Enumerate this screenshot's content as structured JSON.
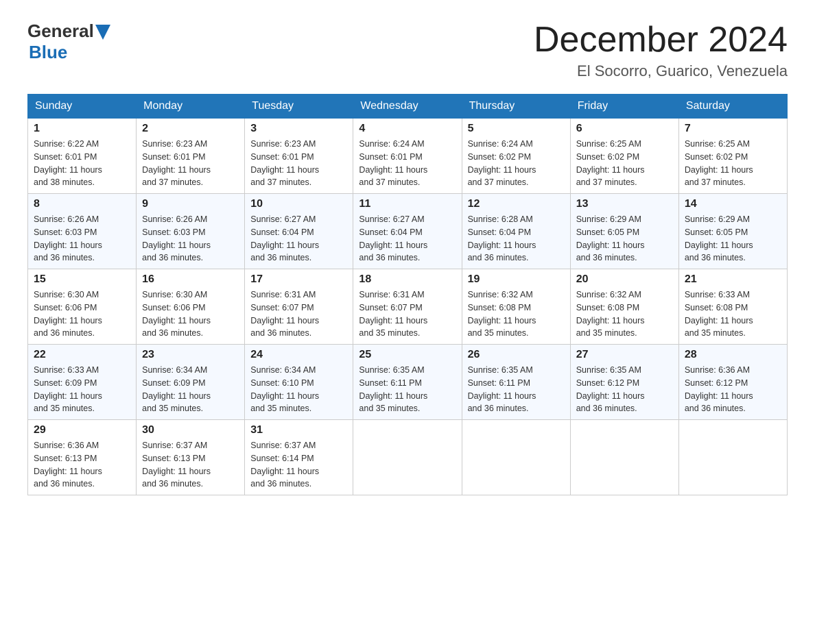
{
  "header": {
    "logo_general": "General",
    "logo_blue": "Blue",
    "month_title": "December 2024",
    "location": "El Socorro, Guarico, Venezuela"
  },
  "days_of_week": [
    "Sunday",
    "Monday",
    "Tuesday",
    "Wednesday",
    "Thursday",
    "Friday",
    "Saturday"
  ],
  "weeks": [
    [
      {
        "day": "1",
        "sunrise": "6:22 AM",
        "sunset": "6:01 PM",
        "daylight": "11 hours and 38 minutes."
      },
      {
        "day": "2",
        "sunrise": "6:23 AM",
        "sunset": "6:01 PM",
        "daylight": "11 hours and 37 minutes."
      },
      {
        "day": "3",
        "sunrise": "6:23 AM",
        "sunset": "6:01 PM",
        "daylight": "11 hours and 37 minutes."
      },
      {
        "day": "4",
        "sunrise": "6:24 AM",
        "sunset": "6:01 PM",
        "daylight": "11 hours and 37 minutes."
      },
      {
        "day": "5",
        "sunrise": "6:24 AM",
        "sunset": "6:02 PM",
        "daylight": "11 hours and 37 minutes."
      },
      {
        "day": "6",
        "sunrise": "6:25 AM",
        "sunset": "6:02 PM",
        "daylight": "11 hours and 37 minutes."
      },
      {
        "day": "7",
        "sunrise": "6:25 AM",
        "sunset": "6:02 PM",
        "daylight": "11 hours and 37 minutes."
      }
    ],
    [
      {
        "day": "8",
        "sunrise": "6:26 AM",
        "sunset": "6:03 PM",
        "daylight": "11 hours and 36 minutes."
      },
      {
        "day": "9",
        "sunrise": "6:26 AM",
        "sunset": "6:03 PM",
        "daylight": "11 hours and 36 minutes."
      },
      {
        "day": "10",
        "sunrise": "6:27 AM",
        "sunset": "6:04 PM",
        "daylight": "11 hours and 36 minutes."
      },
      {
        "day": "11",
        "sunrise": "6:27 AM",
        "sunset": "6:04 PM",
        "daylight": "11 hours and 36 minutes."
      },
      {
        "day": "12",
        "sunrise": "6:28 AM",
        "sunset": "6:04 PM",
        "daylight": "11 hours and 36 minutes."
      },
      {
        "day": "13",
        "sunrise": "6:29 AM",
        "sunset": "6:05 PM",
        "daylight": "11 hours and 36 minutes."
      },
      {
        "day": "14",
        "sunrise": "6:29 AM",
        "sunset": "6:05 PM",
        "daylight": "11 hours and 36 minutes."
      }
    ],
    [
      {
        "day": "15",
        "sunrise": "6:30 AM",
        "sunset": "6:06 PM",
        "daylight": "11 hours and 36 minutes."
      },
      {
        "day": "16",
        "sunrise": "6:30 AM",
        "sunset": "6:06 PM",
        "daylight": "11 hours and 36 minutes."
      },
      {
        "day": "17",
        "sunrise": "6:31 AM",
        "sunset": "6:07 PM",
        "daylight": "11 hours and 36 minutes."
      },
      {
        "day": "18",
        "sunrise": "6:31 AM",
        "sunset": "6:07 PM",
        "daylight": "11 hours and 35 minutes."
      },
      {
        "day": "19",
        "sunrise": "6:32 AM",
        "sunset": "6:08 PM",
        "daylight": "11 hours and 35 minutes."
      },
      {
        "day": "20",
        "sunrise": "6:32 AM",
        "sunset": "6:08 PM",
        "daylight": "11 hours and 35 minutes."
      },
      {
        "day": "21",
        "sunrise": "6:33 AM",
        "sunset": "6:08 PM",
        "daylight": "11 hours and 35 minutes."
      }
    ],
    [
      {
        "day": "22",
        "sunrise": "6:33 AM",
        "sunset": "6:09 PM",
        "daylight": "11 hours and 35 minutes."
      },
      {
        "day": "23",
        "sunrise": "6:34 AM",
        "sunset": "6:09 PM",
        "daylight": "11 hours and 35 minutes."
      },
      {
        "day": "24",
        "sunrise": "6:34 AM",
        "sunset": "6:10 PM",
        "daylight": "11 hours and 35 minutes."
      },
      {
        "day": "25",
        "sunrise": "6:35 AM",
        "sunset": "6:11 PM",
        "daylight": "11 hours and 35 minutes."
      },
      {
        "day": "26",
        "sunrise": "6:35 AM",
        "sunset": "6:11 PM",
        "daylight": "11 hours and 36 minutes."
      },
      {
        "day": "27",
        "sunrise": "6:35 AM",
        "sunset": "6:12 PM",
        "daylight": "11 hours and 36 minutes."
      },
      {
        "day": "28",
        "sunrise": "6:36 AM",
        "sunset": "6:12 PM",
        "daylight": "11 hours and 36 minutes."
      }
    ],
    [
      {
        "day": "29",
        "sunrise": "6:36 AM",
        "sunset": "6:13 PM",
        "daylight": "11 hours and 36 minutes."
      },
      {
        "day": "30",
        "sunrise": "6:37 AM",
        "sunset": "6:13 PM",
        "daylight": "11 hours and 36 minutes."
      },
      {
        "day": "31",
        "sunrise": "6:37 AM",
        "sunset": "6:14 PM",
        "daylight": "11 hours and 36 minutes."
      },
      null,
      null,
      null,
      null
    ]
  ],
  "labels": {
    "sunrise": "Sunrise:",
    "sunset": "Sunset:",
    "daylight": "Daylight:"
  }
}
